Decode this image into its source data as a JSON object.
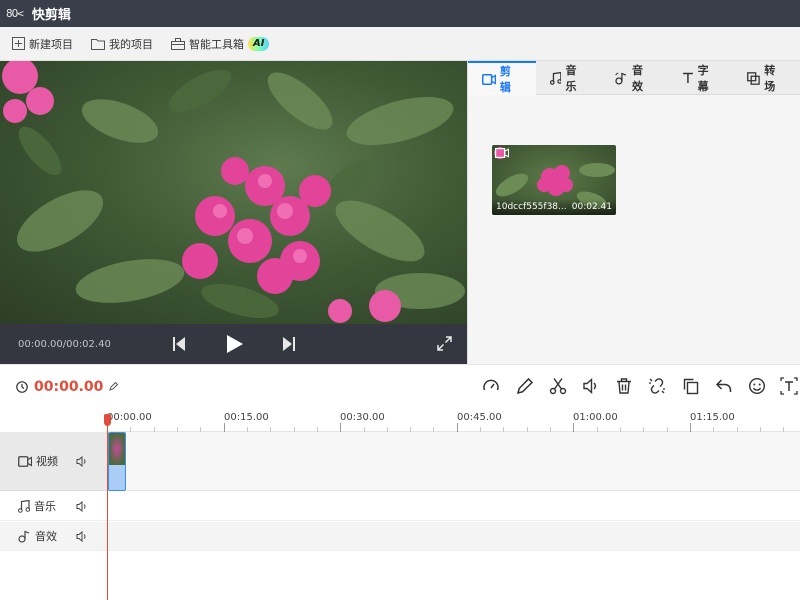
{
  "app": {
    "logo_text": "8O<",
    "title": "快剪辑"
  },
  "menu": {
    "new_project": "新建项目",
    "my_projects": "我的项目",
    "ai_toolbox": "智能工具箱",
    "ai_badge": "AI"
  },
  "player": {
    "time": "00:00.00/00:02.40"
  },
  "tabs": [
    {
      "label": "剪辑",
      "icon": "video-camera-icon",
      "active": true
    },
    {
      "label": "音乐",
      "icon": "music-note-icon",
      "active": false
    },
    {
      "label": "音效",
      "icon": "sound-effect-icon",
      "active": false
    },
    {
      "label": "字幕",
      "icon": "text-t-icon",
      "active": false
    },
    {
      "label": "转场",
      "icon": "transition-icon",
      "active": false
    }
  ],
  "clip": {
    "filename": "10dccf555f38...",
    "duration": "00:02.41"
  },
  "timeline": {
    "current_time": "00:00.00",
    "ticks": [
      "00:00.00",
      "00:15.00",
      "00:30.00",
      "00:45.00",
      "01:00.00",
      "01:15.00"
    ],
    "tracks": [
      {
        "label": "视频",
        "icon": "video-camera-icon"
      },
      {
        "label": "音乐",
        "icon": "music-note-icon"
      },
      {
        "label": "音效",
        "icon": "sound-effect-icon"
      }
    ]
  },
  "colors": {
    "accent": "#1677ff",
    "time_red": "#e24d3b",
    "titlebar": "#3a3e4a",
    "player_bar": "#34373f"
  }
}
